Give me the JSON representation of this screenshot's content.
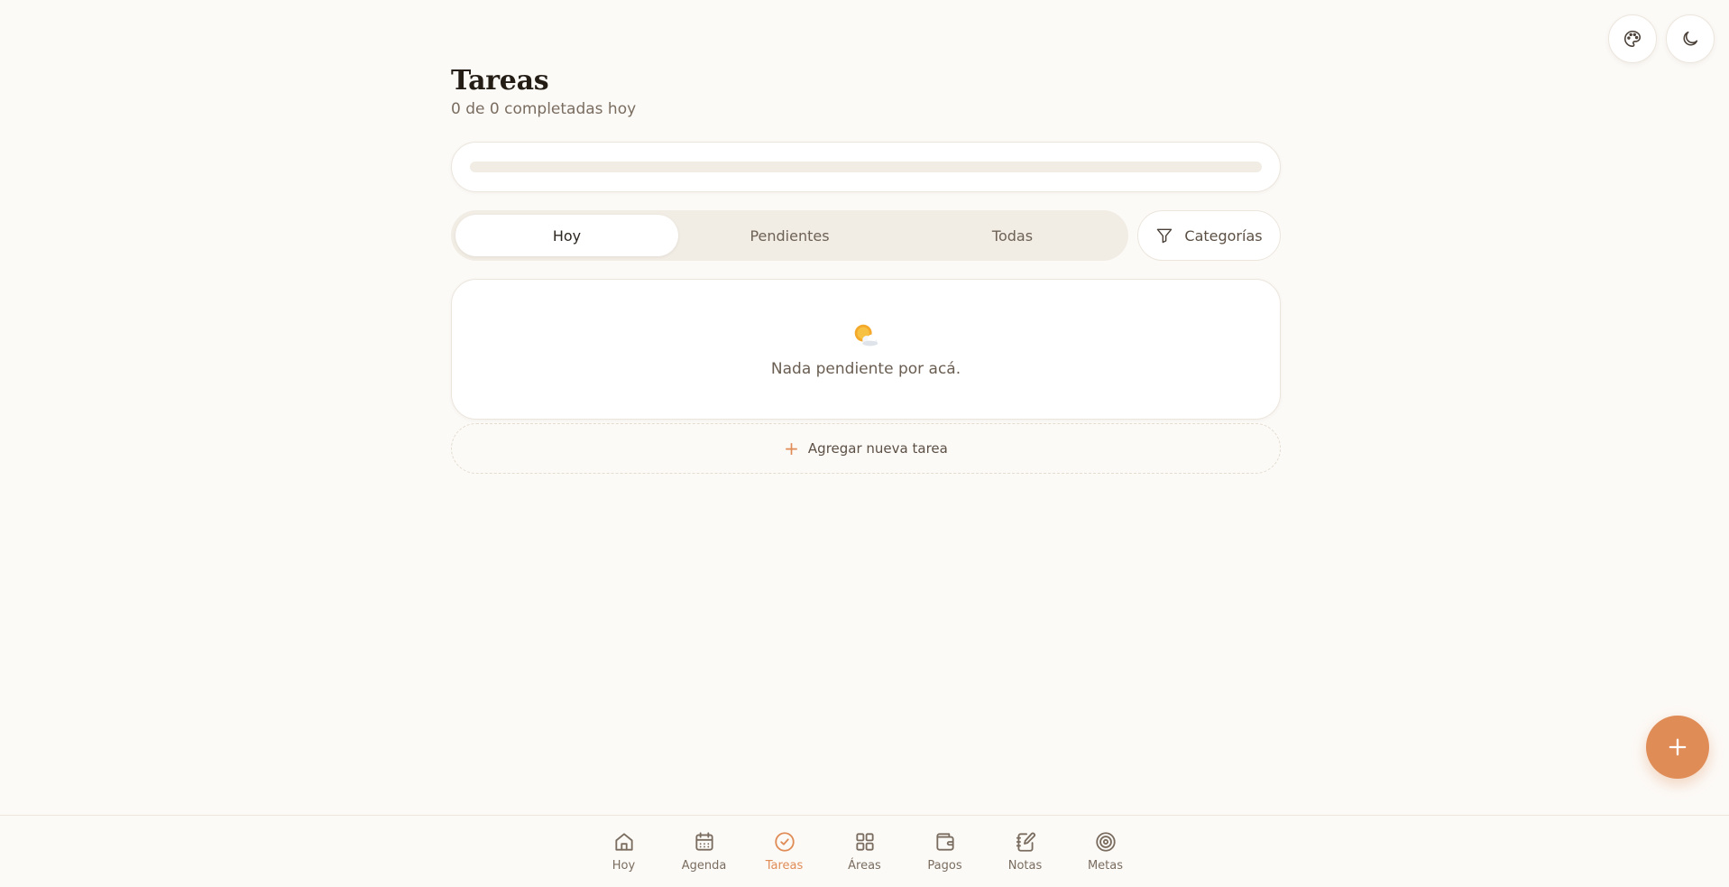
{
  "header": {
    "title": "Tareas",
    "subtitle": "0 de 0 completadas hoy"
  },
  "top_actions": {
    "palette_icon": "palette-icon",
    "theme_icon": "moon-icon"
  },
  "progress": {
    "fraction": 0
  },
  "filters": {
    "tabs": [
      {
        "label": "Hoy",
        "active": true
      },
      {
        "label": "Pendientes",
        "active": false
      },
      {
        "label": "Todas",
        "active": false
      }
    ],
    "categories_label": "Categorías",
    "categories_icon": "filter-icon"
  },
  "empty_state": {
    "icon": "sun-behind-cloud-icon",
    "message": "Nada pendiente por acá."
  },
  "add_task": {
    "label": "Agregar nueva tarea",
    "icon": "plus-icon"
  },
  "fab": {
    "icon": "plus-icon"
  },
  "bottom_nav": {
    "items": [
      {
        "label": "Hoy",
        "icon": "home-icon",
        "active": false
      },
      {
        "label": "Agenda",
        "icon": "calendar-icon",
        "active": false
      },
      {
        "label": "Tareas",
        "icon": "check-circle-icon",
        "active": true
      },
      {
        "label": "Áreas",
        "icon": "grid-icon",
        "active": false
      },
      {
        "label": "Pagos",
        "icon": "wallet-icon",
        "active": false
      },
      {
        "label": "Notas",
        "icon": "notebook-icon",
        "active": false
      },
      {
        "label": "Metas",
        "icon": "target-icon",
        "active": false
      }
    ]
  },
  "colors": {
    "accent": "#e08c57",
    "background": "#fcfaf7",
    "segment_bg": "#f1ece4"
  }
}
